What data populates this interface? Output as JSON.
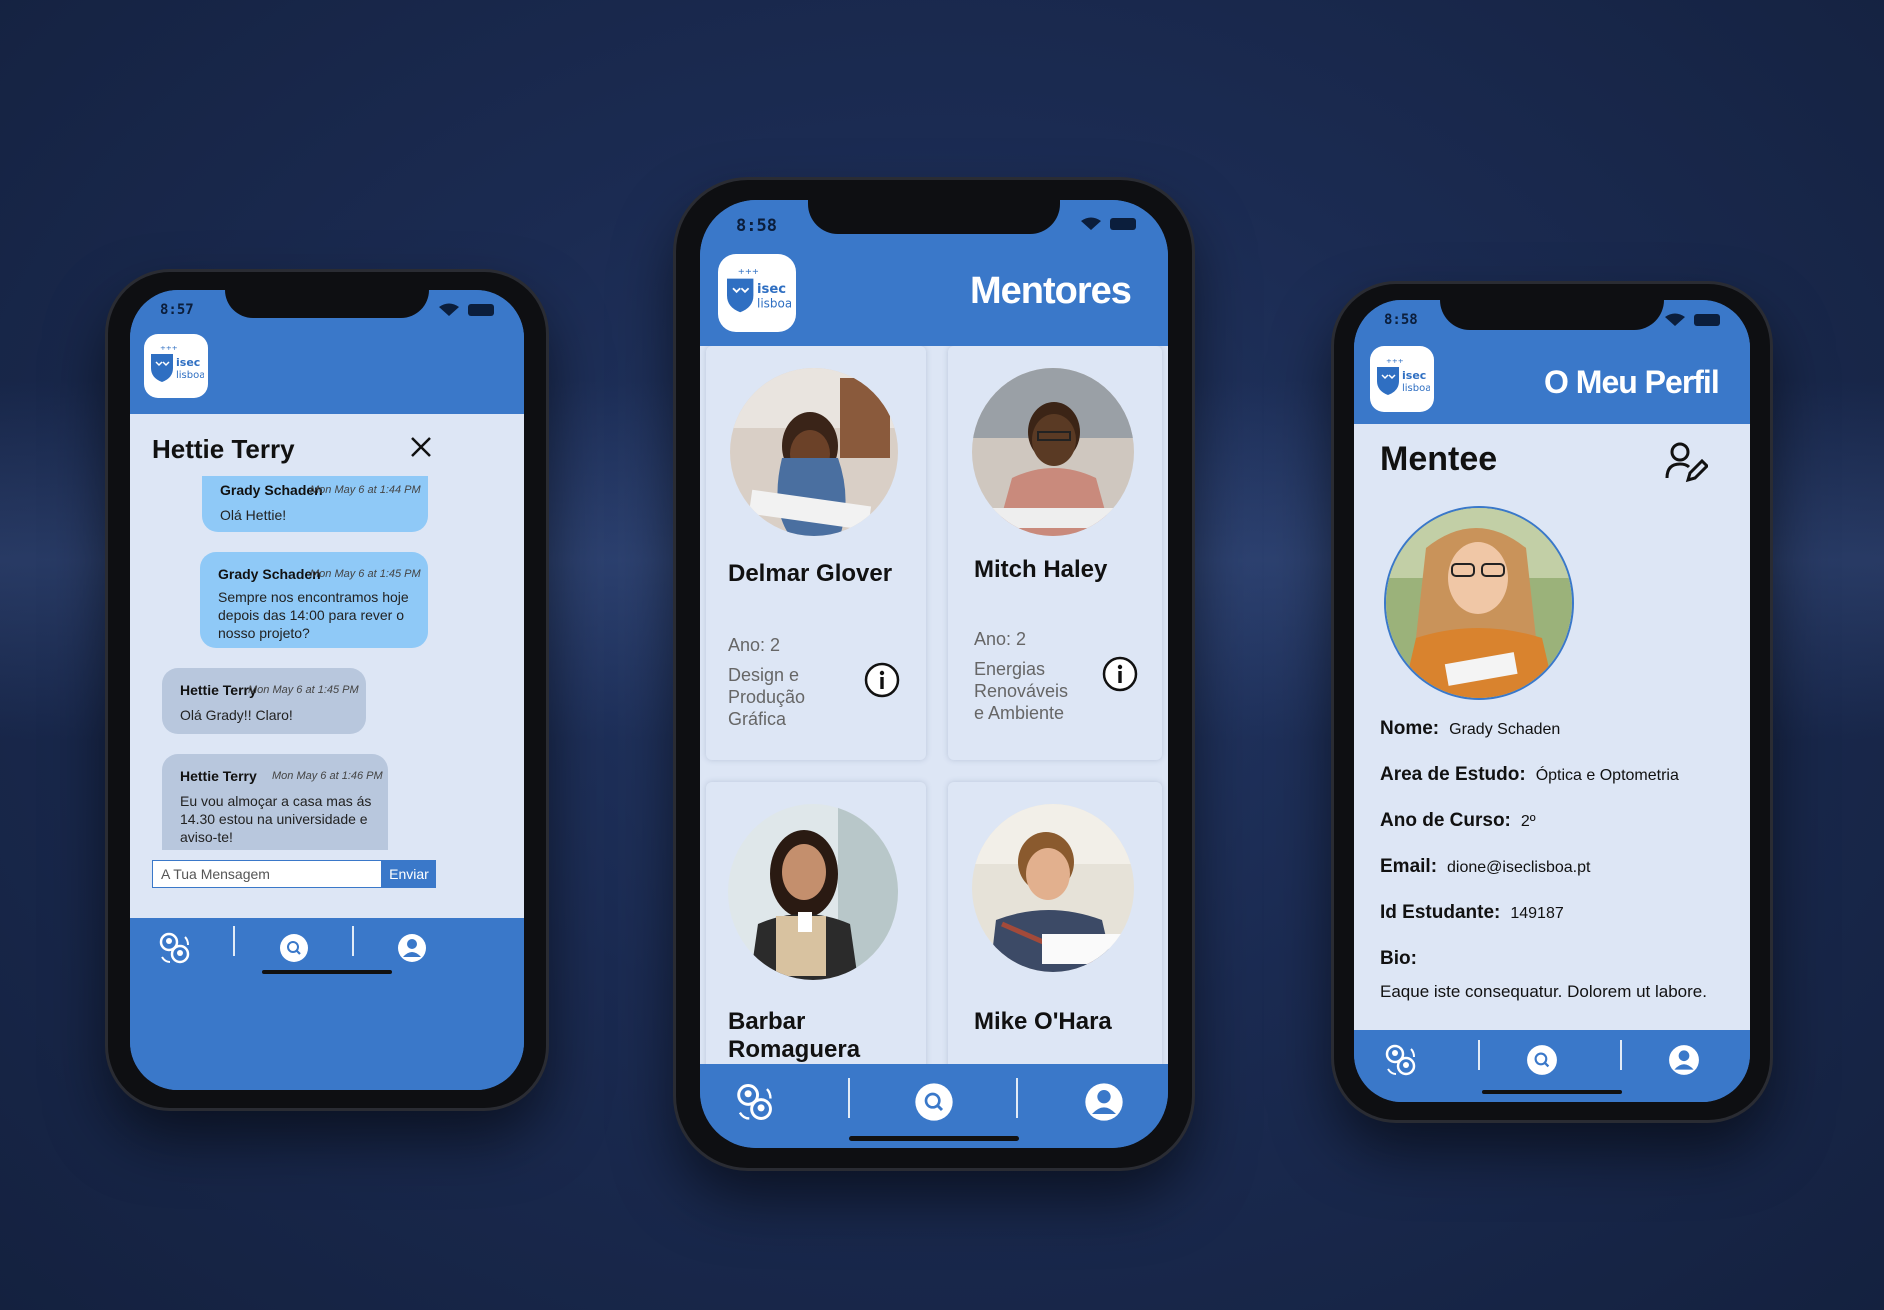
{
  "colors": {
    "primary": "#3a78c9",
    "surface": "#dde6f5",
    "bubble_out": "#8fc9f7",
    "bubble_in": "#b8c7dd"
  },
  "logo": {
    "line1": "isec",
    "line2": "lisboa"
  },
  "nav": {
    "icons": [
      "mentors-group-icon",
      "search-icon",
      "profile-icon"
    ]
  },
  "chat_phone": {
    "time": "8:57",
    "title": "Hettie Terry",
    "messages": [
      {
        "sender": "Grady Schaden",
        "time": "Mon May 6 at 1:44 PM",
        "text": "Olá Hettie!",
        "direction": "out"
      },
      {
        "sender": "Grady Schaden",
        "time": "Mon May 6 at 1:45 PM",
        "text": "Sempre nos encontramos hoje depois das 14:00 para rever o nosso projeto?",
        "direction": "out"
      },
      {
        "sender": "Hettie Terry",
        "time": "Mon May 6 at 1:45 PM",
        "text": "Olá Grady!! Claro!",
        "direction": "in"
      },
      {
        "sender": "Hettie Terry",
        "time": "Mon May 6 at 1:46 PM",
        "text": "Eu vou almoçar a casa mas ás 14.30 estou na universidade e aviso-te!",
        "direction": "in"
      }
    ],
    "input_placeholder": "A Tua Mensagem",
    "send_label": "Enviar"
  },
  "mentors_phone": {
    "time": "8:58",
    "title": "Mentores",
    "mentors": [
      {
        "name": "Delmar Glover",
        "year": "Ano: 2",
        "area": "Design e Produção Gráfica"
      },
      {
        "name": "Mitch Haley",
        "year": "Ano: 2",
        "area": "Energias Renováveis e Ambiente"
      },
      {
        "name": "Barbar Romaguera",
        "year": "",
        "area": ""
      },
      {
        "name": "Mike O'Hara",
        "year": "",
        "area": ""
      }
    ]
  },
  "profile_phone": {
    "time": "8:58",
    "title": "O Meu Perfil",
    "role": "Mentee",
    "fields": [
      {
        "label": "Nome:",
        "value": "Grady Schaden"
      },
      {
        "label": "Area de Estudo:",
        "value": "Óptica e Optometria"
      },
      {
        "label": "Ano de Curso:",
        "value": "2º"
      },
      {
        "label": "Email:",
        "value": "dione@iseclisboa.pt"
      },
      {
        "label": "Id Estudante:",
        "value": "149187"
      }
    ],
    "bio_label": "Bio:",
    "bio_text": "Eaque iste consequatur. Dolorem ut labore."
  }
}
